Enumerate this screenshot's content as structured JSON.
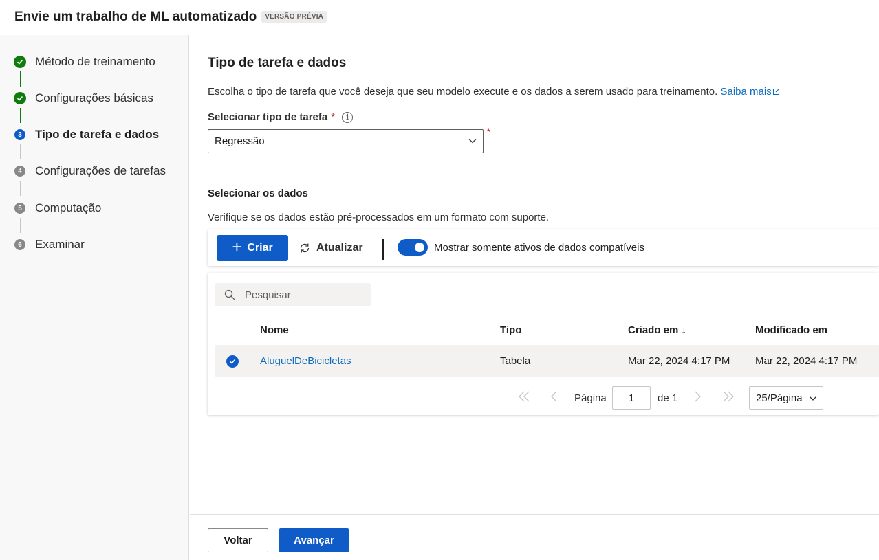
{
  "header": {
    "title": "Envie um trabalho de ML automatizado",
    "badge": "VERSÃO PRÉVIA"
  },
  "steps": [
    {
      "num": "1",
      "label": "Método de treinamento",
      "state": "done"
    },
    {
      "num": "2",
      "label": "Configurações básicas",
      "state": "done"
    },
    {
      "num": "3",
      "label": "Tipo de tarefa e dados",
      "state": "current"
    },
    {
      "num": "4",
      "label": "Configurações de tarefas",
      "state": "todo"
    },
    {
      "num": "5",
      "label": "Computação",
      "state": "todo"
    },
    {
      "num": "6",
      "label": "Examinar",
      "state": "todo"
    }
  ],
  "main": {
    "heading": "Tipo de tarefa e dados",
    "description": "Escolha o tipo de tarefa que você deseja que seu modelo execute e os dados a serem usado para treinamento.",
    "learn_more": "Saiba mais",
    "task_label": "Selecionar tipo de tarefa",
    "required_mark": "*",
    "task_value": "Regressão",
    "data_heading": "Selecionar os dados",
    "data_description": "Verifique se os dados estão pré-processados em um formato com suporte."
  },
  "toolbar": {
    "create": "Criar",
    "refresh": "Atualizar",
    "toggle_label": "Mostrar somente ativos de dados compatíveis",
    "toggle_on": true
  },
  "grid": {
    "search_placeholder": "Pesquisar",
    "columns": [
      "Nome",
      "Tipo",
      "Criado em ↓",
      "Modificado em"
    ],
    "rows": [
      {
        "name": "AluguelDeBicicletas",
        "type": "Tabela",
        "created": "Mar 22, 2024 4:17 PM",
        "modified": "Mar 22, 2024 4:17 PM",
        "selected": true
      }
    ]
  },
  "pager": {
    "page_label": "Página",
    "page_value": "1",
    "of_label": "de 1",
    "page_size": "25/Página"
  },
  "footer": {
    "back": "Voltar",
    "next": "Avançar"
  },
  "colors": {
    "primary": "#0f5cc9",
    "success": "#107c10",
    "link": "#0f6cbd",
    "required": "#c50f1f"
  }
}
